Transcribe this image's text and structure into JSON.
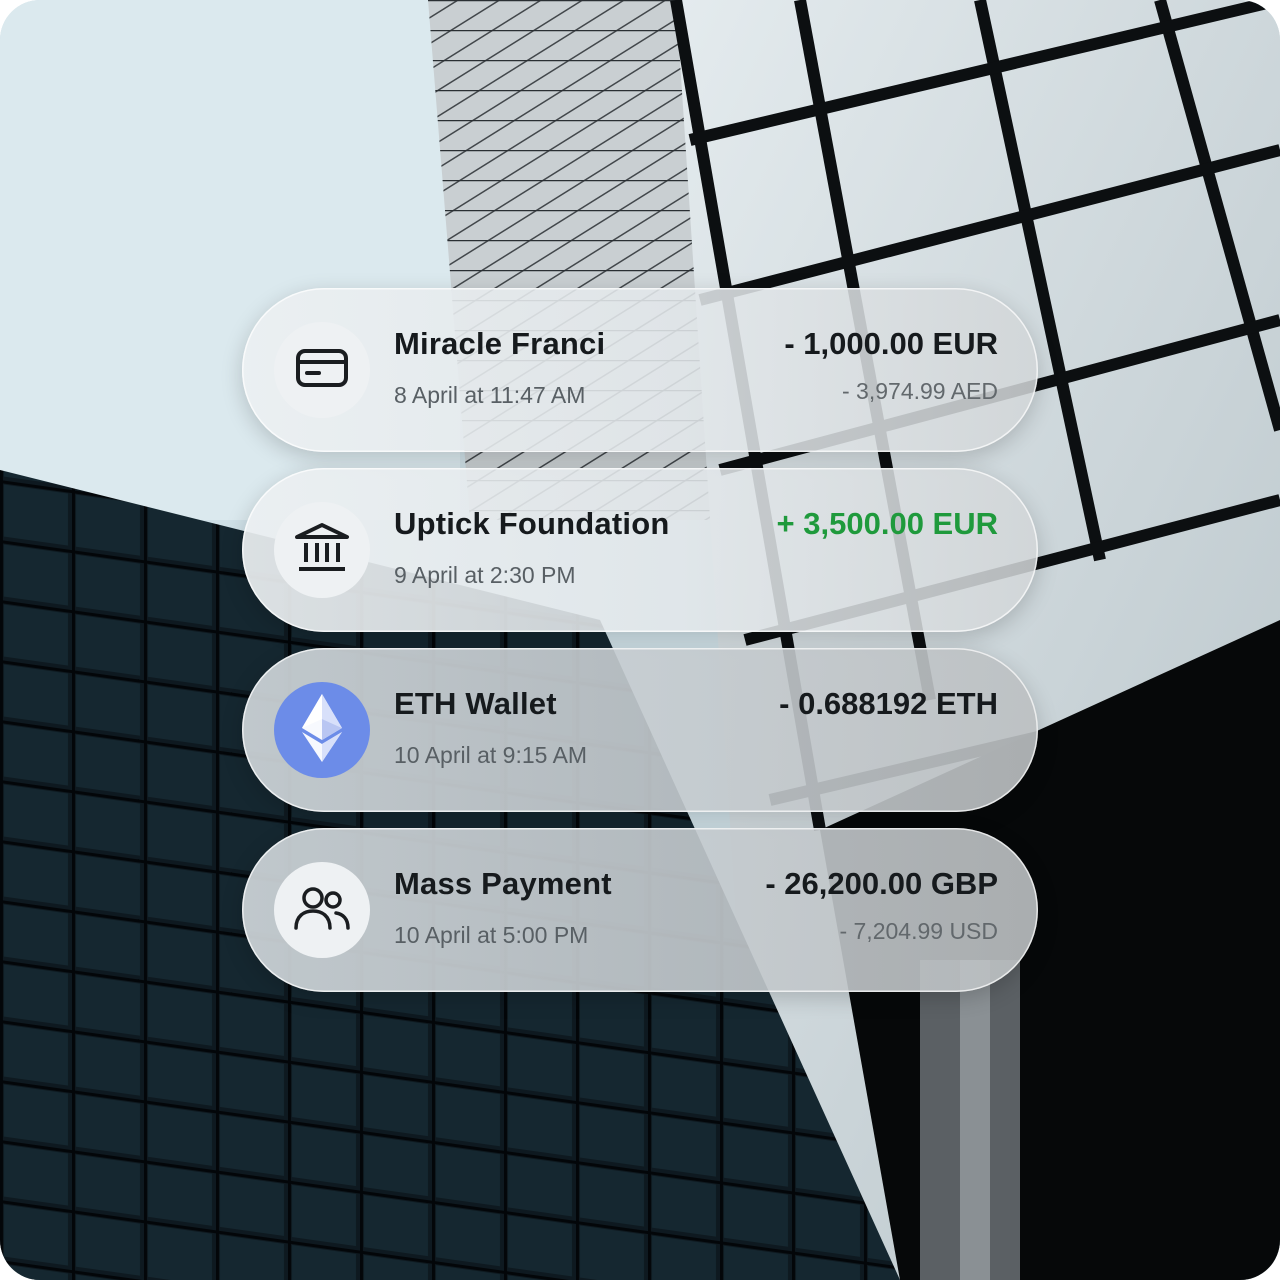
{
  "transactions": [
    {
      "icon": "card-icon",
      "name": "Miracle Franci",
      "datetime": "8 April at 11:47 AM",
      "amount": "- 1,000.00 EUR",
      "amount_secondary": "- 3,974.99 AED",
      "direction": "outgoing"
    },
    {
      "icon": "bank-icon",
      "name": "Uptick Foundation",
      "datetime": "9 April at 2:30 PM",
      "amount": "+ 3,500.00 EUR",
      "amount_secondary": "",
      "direction": "incoming"
    },
    {
      "icon": "ethereum-icon",
      "name": "ETH Wallet",
      "datetime": "10 April at 9:15 AM",
      "amount": "- 0.688192 ETH",
      "amount_secondary": "",
      "direction": "outgoing"
    },
    {
      "icon": "users-icon",
      "name": "Mass Payment",
      "datetime": "10 April at 5:00 PM",
      "amount": "- 26,200.00 GBP",
      "amount_secondary": "- 7,204.99 USD",
      "direction": "outgoing"
    }
  ],
  "colors": {
    "positive_amount": "#1f9a3c",
    "ethereum_badge": "#6c8ce8",
    "text_primary": "#161a1d"
  }
}
